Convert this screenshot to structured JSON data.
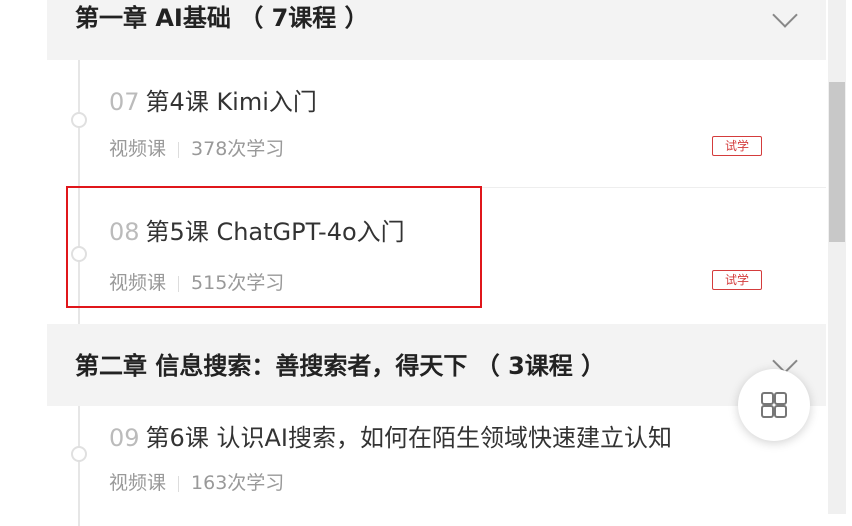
{
  "chapters": [
    {
      "title": "第一章 AI基础 （ 7课程 ）"
    },
    {
      "title": "第二章 信息搜索：善搜索者，得天下 （ 3课程 ）"
    }
  ],
  "lessons": [
    {
      "num": "07",
      "title": "第4课 Kimi入门",
      "type": "视频课",
      "count": "378次学习",
      "badge": "试学"
    },
    {
      "num": "08",
      "title": "第5课 ChatGPT-4o入门",
      "type": "视频课",
      "count": "515次学习",
      "badge": "试学"
    },
    {
      "num": "09",
      "title": "第6课 认识AI搜索，如何在陌生领域快速建立认知",
      "type": "视频课",
      "count": "163次学习"
    }
  ],
  "icons": {
    "chevron": "chevron-down-icon",
    "float": "grid-icon"
  },
  "colors": {
    "accent": "#d43c3c",
    "highlight": "#e0161b"
  }
}
